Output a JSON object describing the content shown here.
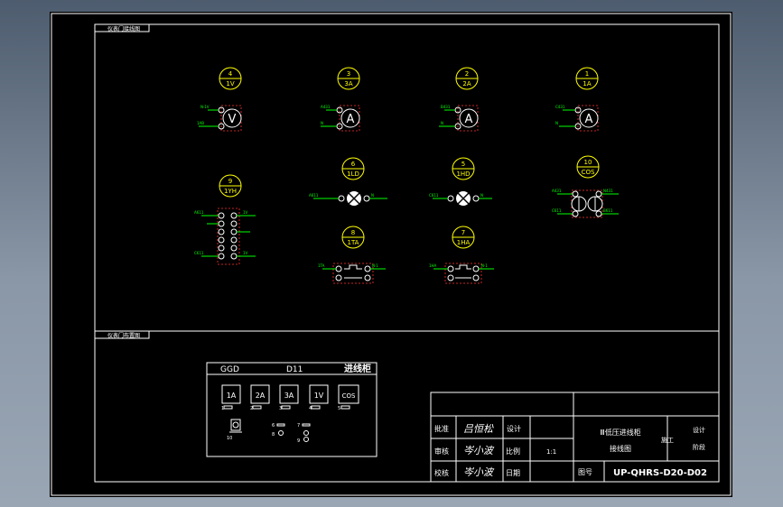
{
  "sections": {
    "back_view": "仪表门接线图",
    "front_view": "仪表门布置图"
  },
  "colors": {
    "frame": "#ffffff",
    "bubble": "#ffff00",
    "device": "#ffffff",
    "wire": "#00ff00",
    "dash": "#ff3030"
  },
  "components": [
    {
      "num": "4",
      "code": "1V",
      "symbol": "V"
    },
    {
      "num": "3",
      "code": "3A",
      "symbol": "A"
    },
    {
      "num": "2",
      "code": "2A",
      "symbol": "A"
    },
    {
      "num": "1",
      "code": "1A",
      "symbol": "A"
    },
    {
      "num": "9",
      "code": "1YH",
      "symbol": ""
    },
    {
      "num": "6",
      "code": "1LD",
      "symbol": ""
    },
    {
      "num": "5",
      "code": "1HD",
      "symbol": ""
    },
    {
      "num": "10",
      "code": "COS",
      "symbol": ""
    },
    {
      "num": "8",
      "code": "1TA",
      "symbol": ""
    },
    {
      "num": "7",
      "code": "1HA",
      "symbol": ""
    }
  ],
  "panel": {
    "model": "GGD",
    "designation": "D11",
    "name": "进线柜",
    "meters": [
      "1A",
      "2A",
      "3A",
      "1V",
      "COS"
    ],
    "meter_nums": [
      "1",
      "2",
      "3",
      "4",
      "5"
    ],
    "row2_nums": [
      "10",
      "6",
      "8",
      "7",
      "9"
    ]
  },
  "title_block": {
    "approve_label": "批准",
    "approve_sign": "吕恒松",
    "design_label": "设计",
    "review_label": "审核",
    "review_sign": "岑小波",
    "scale_label": "比例",
    "scale_value": "1:1",
    "check_label": "校核",
    "check_sign": "岑小波",
    "date_label": "日期",
    "drawing_title_1": "Ⅲ低压进线柜",
    "drawing_title_2": "接线图",
    "stage_label": "施工",
    "design_stage": "设计",
    "stage": "阶段",
    "drawing_no_label": "图号",
    "drawing_no": "UP-QHRS-D20-D02"
  }
}
